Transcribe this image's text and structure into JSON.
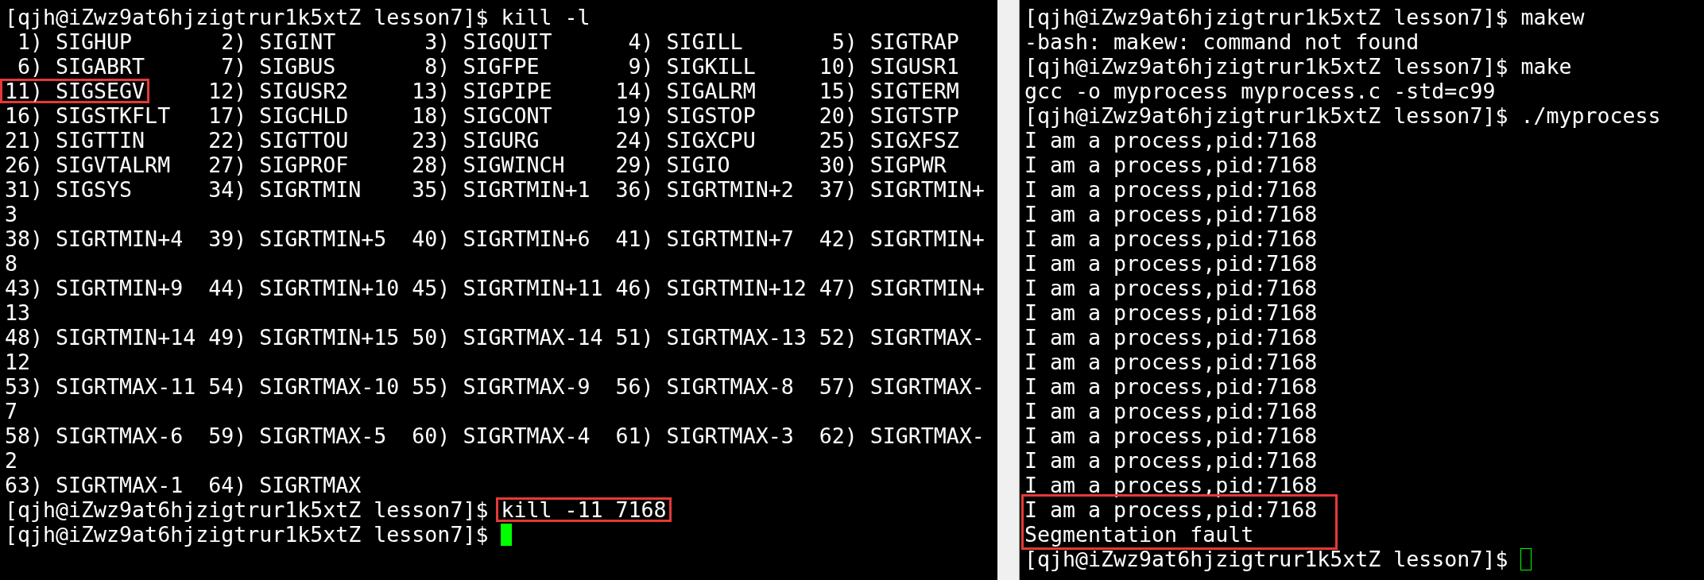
{
  "panes": [
    {
      "focused": true,
      "lines": [
        {
          "text": "[qjh@iZwz9at6hjzigtrur1k5xtZ lesson7]$ kill -l"
        },
        {
          "text": " 1) SIGHUP       2) SIGINT       3) SIGQUIT      4) SIGILL       5) SIGTRAP"
        },
        {
          "text": " 6) SIGABRT      7) SIGBUS       8) SIGFPE       9) SIGKILL     10) SIGUSR1"
        },
        {
          "segments": [
            {
              "text": "11) SIGSEGV",
              "boxed": true
            },
            {
              "text": "     12) SIGUSR2     13) SIGPIPE     14) SIGALRM     15) SIGTERM",
              "boxed": false
            }
          ]
        },
        {
          "text": "16) SIGSTKFLT   17) SIGCHLD     18) SIGCONT     19) SIGSTOP     20) SIGTSTP"
        },
        {
          "text": "21) SIGTTIN     22) SIGTTOU     23) SIGURG      24) SIGXCPU     25) SIGXFSZ"
        },
        {
          "text": "26) SIGVTALRM   27) SIGPROF     28) SIGWINCH    29) SIGIO       30) SIGPWR"
        },
        {
          "text": "31) SIGSYS      34) SIGRTMIN    35) SIGRTMIN+1  36) SIGRTMIN+2  37) SIGRTMIN+"
        },
        {
          "text": "3"
        },
        {
          "text": "38) SIGRTMIN+4  39) SIGRTMIN+5  40) SIGRTMIN+6  41) SIGRTMIN+7  42) SIGRTMIN+"
        },
        {
          "text": "8"
        },
        {
          "text": "43) SIGRTMIN+9  44) SIGRTMIN+10 45) SIGRTMIN+11 46) SIGRTMIN+12 47) SIGRTMIN+"
        },
        {
          "text": "13"
        },
        {
          "text": "48) SIGRTMIN+14 49) SIGRTMIN+15 50) SIGRTMAX-14 51) SIGRTMAX-13 52) SIGRTMAX-"
        },
        {
          "text": "12"
        },
        {
          "text": "53) SIGRTMAX-11 54) SIGRTMAX-10 55) SIGRTMAX-9  56) SIGRTMAX-8  57) SIGRTMAX-"
        },
        {
          "text": "7"
        },
        {
          "text": "58) SIGRTMAX-6  59) SIGRTMAX-5  60) SIGRTMAX-4  61) SIGRTMAX-3  62) SIGRTMAX-"
        },
        {
          "text": "2"
        },
        {
          "text": "63) SIGRTMAX-1  64) SIGRTMAX"
        },
        {
          "segments": [
            {
              "text": "[qjh@iZwz9at6hjzigtrur1k5xtZ lesson7]$ ",
              "boxed": false
            },
            {
              "text": "kill -11 7168",
              "boxed": true
            }
          ]
        },
        {
          "text": "[qjh@iZwz9at6hjzigtrur1k5xtZ lesson7]$ ",
          "cursor": true
        }
      ]
    },
    {
      "focused": false,
      "lines": [
        {
          "text": "[qjh@iZwz9at6hjzigtrur1k5xtZ lesson7]$ makew"
        },
        {
          "text": "-bash: makew: command not found"
        },
        {
          "text": "[qjh@iZwz9at6hjzigtrur1k5xtZ lesson7]$ make"
        },
        {
          "text": "gcc -o myprocess myprocess.c -std=c99"
        },
        {
          "text": "[qjh@iZwz9at6hjzigtrur1k5xtZ lesson7]$ ./myprocess"
        },
        {
          "text": "I am a process,pid:7168"
        },
        {
          "text": "I am a process,pid:7168"
        },
        {
          "text": "I am a process,pid:7168"
        },
        {
          "text": "I am a process,pid:7168"
        },
        {
          "text": "I am a process,pid:7168"
        },
        {
          "text": "I am a process,pid:7168"
        },
        {
          "text": "I am a process,pid:7168"
        },
        {
          "text": "I am a process,pid:7168"
        },
        {
          "text": "I am a process,pid:7168"
        },
        {
          "text": "I am a process,pid:7168"
        },
        {
          "text": "I am a process,pid:7168"
        },
        {
          "text": "I am a process,pid:7168"
        },
        {
          "text": "I am a process,pid:7168"
        },
        {
          "text": "I am a process,pid:7168"
        },
        {
          "text": "I am a process,pid:7168"
        },
        {
          "boxed_lines": [
            "I am a process,pid:7168",
            "Segmentation fault"
          ]
        },
        {
          "text": "[qjh@iZwz9at6hjzigtrur1k5xtZ lesson7]$ ",
          "cursor": true
        }
      ]
    }
  ]
}
